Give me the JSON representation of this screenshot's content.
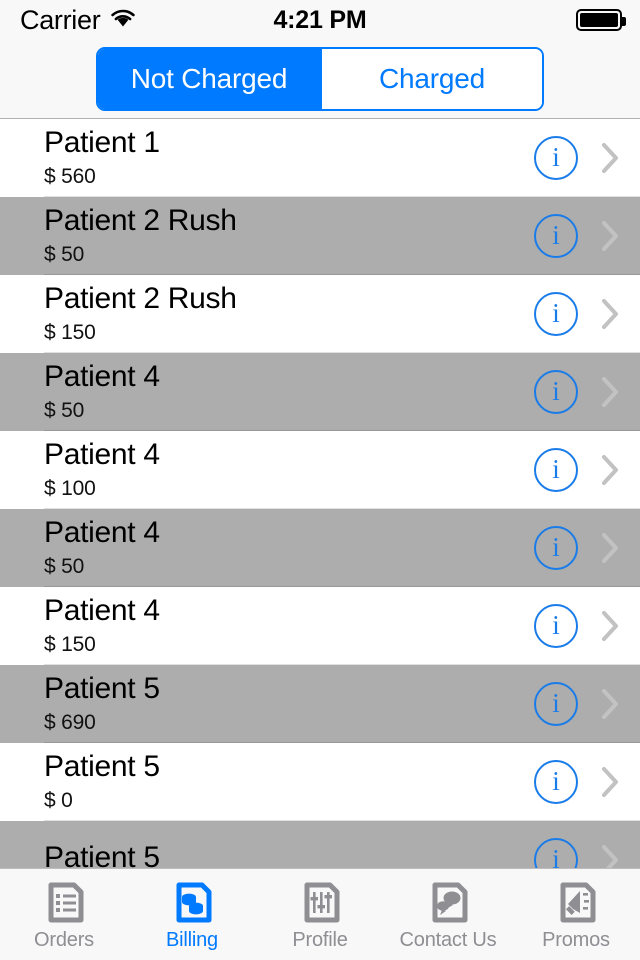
{
  "status_bar": {
    "carrier": "Carrier",
    "wifi_icon": "wifi-icon",
    "time": "4:21 PM",
    "battery_icon": "battery-full-icon"
  },
  "segmented_control": {
    "options": [
      {
        "label": "Not Charged",
        "selected": true
      },
      {
        "label": "Charged",
        "selected": false
      }
    ],
    "accent_color": "#007AFF"
  },
  "list": {
    "row_alt_color": "#ADADAD",
    "info_icon": "info-circle-icon",
    "disclosure_icon": "chevron-right-icon",
    "rows": [
      {
        "name": "Patient 1",
        "price": "$ 560"
      },
      {
        "name": "Patient 2 Rush",
        "price": "$ 50"
      },
      {
        "name": "Patient 2 Rush",
        "price": "$ 150"
      },
      {
        "name": "Patient 4",
        "price": "$ 50"
      },
      {
        "name": "Patient 4",
        "price": "$ 100"
      },
      {
        "name": "Patient 4",
        "price": "$ 50"
      },
      {
        "name": "Patient 4",
        "price": "$ 150"
      },
      {
        "name": "Patient 5",
        "price": "$ 690"
      },
      {
        "name": "Patient 5",
        "price": "$ 0"
      },
      {
        "name": "Patient 5",
        "price": ""
      }
    ]
  },
  "tab_bar": {
    "active_color": "#007AFF",
    "inactive_color": "#8E8E93",
    "tabs": [
      {
        "label": "Orders",
        "icon": "orders-document-icon",
        "active": false
      },
      {
        "label": "Billing",
        "icon": "billing-coins-icon",
        "active": true
      },
      {
        "label": "Profile",
        "icon": "profile-sliders-icon",
        "active": false
      },
      {
        "label": "Contact Us",
        "icon": "contact-chat-icon",
        "active": false
      },
      {
        "label": "Promos",
        "icon": "promos-megaphone-icon",
        "active": false
      }
    ]
  }
}
